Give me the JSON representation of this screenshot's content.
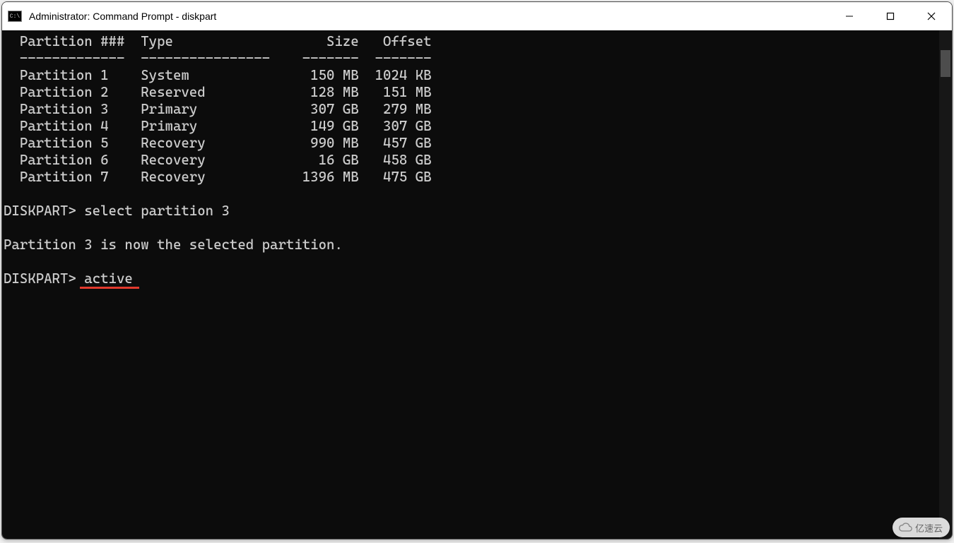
{
  "window": {
    "title": "Administrator: Command Prompt - diskpart"
  },
  "terminal": {
    "header_partition": "  Partition ###",
    "header_type": "Type",
    "header_size": "Size",
    "header_offset": "Offset",
    "sep_partition": "  -------------",
    "sep_type": "----------------",
    "sep_size": "-------",
    "sep_offset": "-------",
    "rows": [
      {
        "partition": "  Partition 1",
        "type": "System",
        "size": "150 MB",
        "offset": "1024 KB"
      },
      {
        "partition": "  Partition 2",
        "type": "Reserved",
        "size": "128 MB",
        "offset": "151 MB"
      },
      {
        "partition": "  Partition 3",
        "type": "Primary",
        "size": "307 GB",
        "offset": "279 MB"
      },
      {
        "partition": "  Partition 4",
        "type": "Primary",
        "size": "149 GB",
        "offset": "307 GB"
      },
      {
        "partition": "  Partition 5",
        "type": "Recovery",
        "size": "990 MB",
        "offset": "457 GB"
      },
      {
        "partition": "  Partition 6",
        "type": "Recovery",
        "size": "16 GB",
        "offset": "458 GB"
      },
      {
        "partition": "  Partition 7",
        "type": "Recovery",
        "size": "1396 MB",
        "offset": "475 GB"
      }
    ],
    "prompt1": "DISKPART> ",
    "command1": "select partition 3",
    "response1": "Partition 3 is now the selected partition.",
    "prompt2": "DISKPART> ",
    "command2": "active"
  },
  "watermark": {
    "text": "亿速云"
  }
}
